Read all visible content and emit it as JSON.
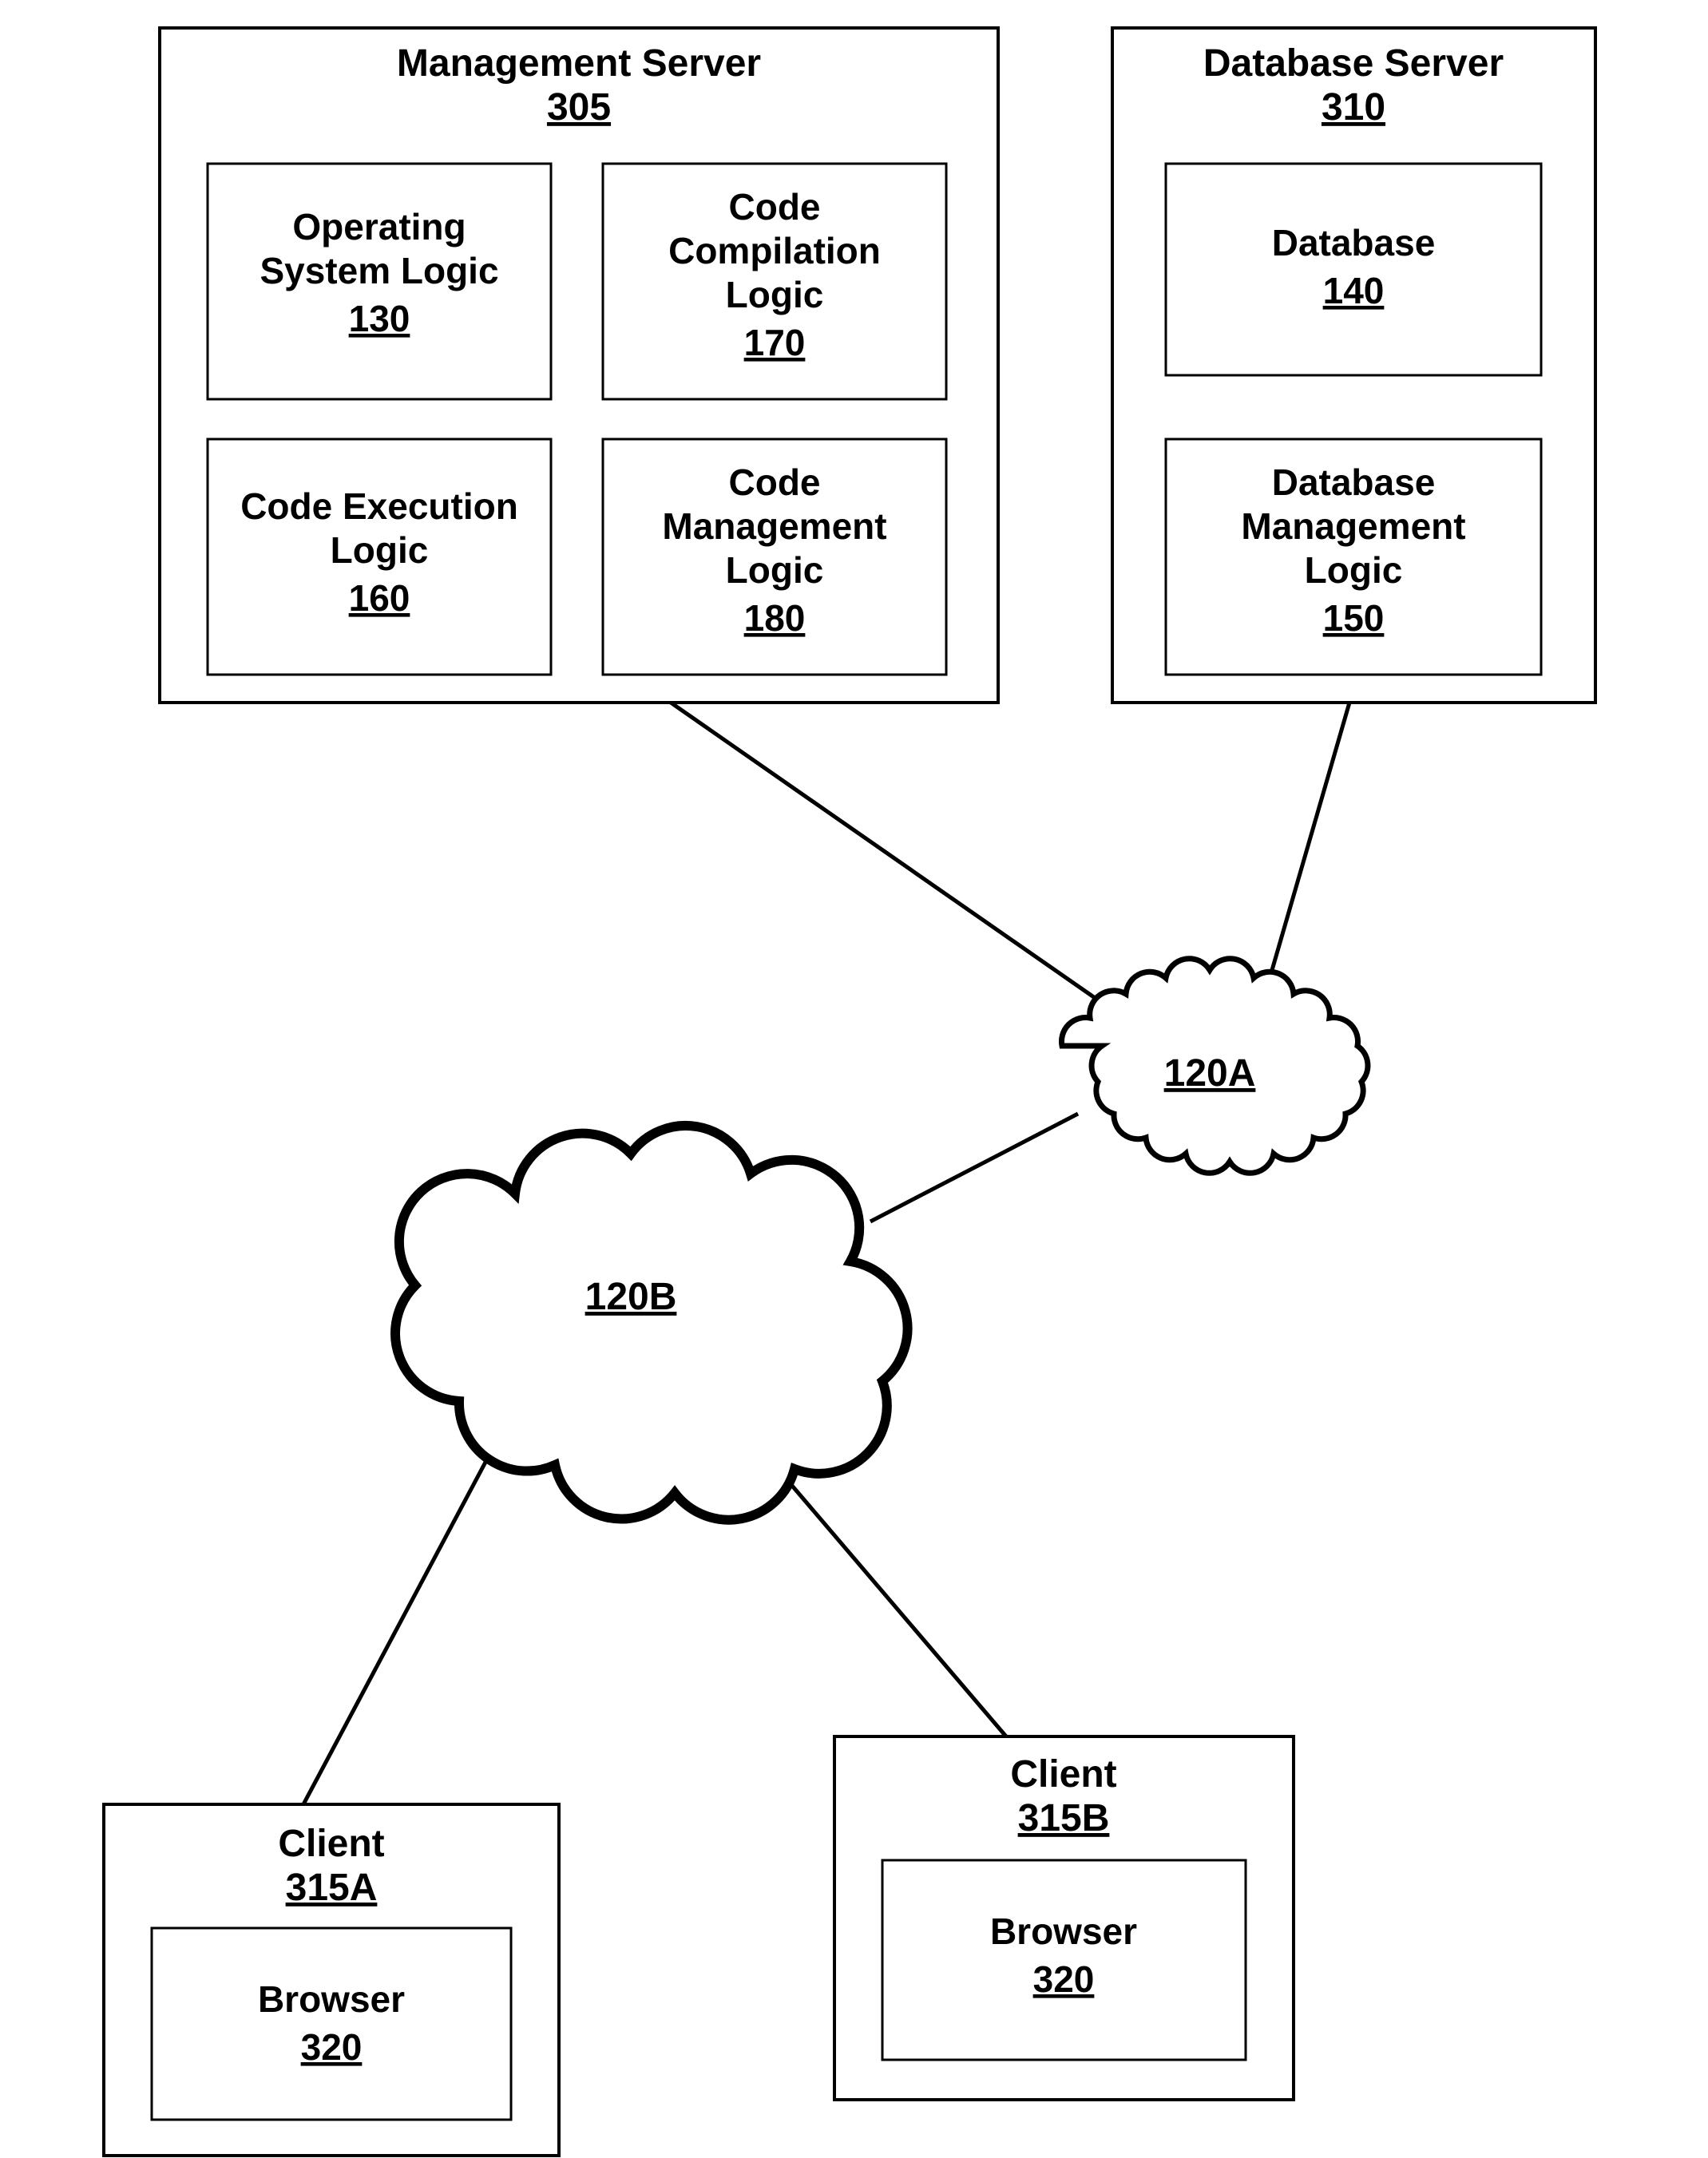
{
  "boxes": {
    "mgmt": {
      "title": "Management Server",
      "ref": "305"
    },
    "dbServer": {
      "title": "Database Server",
      "ref": "310"
    },
    "osLogic": {
      "l1": "Operating",
      "l2": "System Logic",
      "ref": "130"
    },
    "compLogic": {
      "l1": "Code",
      "l2": "Compilation",
      "l3": "Logic",
      "ref": "170"
    },
    "execLogic": {
      "l1": "Code Execution",
      "l2": "Logic",
      "ref": "160"
    },
    "mgmtLogic": {
      "l1": "Code",
      "l2": "Management",
      "l3": "Logic",
      "ref": "180"
    },
    "db": {
      "l1": "Database",
      "ref": "140"
    },
    "dbMgmt": {
      "l1": "Database",
      "l2": "Management",
      "l3": "Logic",
      "ref": "150"
    },
    "clientA": {
      "title": "Client",
      "ref": "315A"
    },
    "clientB": {
      "title": "Client",
      "ref": "315B"
    },
    "browserA": {
      "title": "Browser",
      "ref": "320"
    },
    "browserB": {
      "title": "Browser",
      "ref": "320"
    }
  },
  "clouds": {
    "a": {
      "ref": "120A"
    },
    "b": {
      "ref": "120B"
    }
  }
}
